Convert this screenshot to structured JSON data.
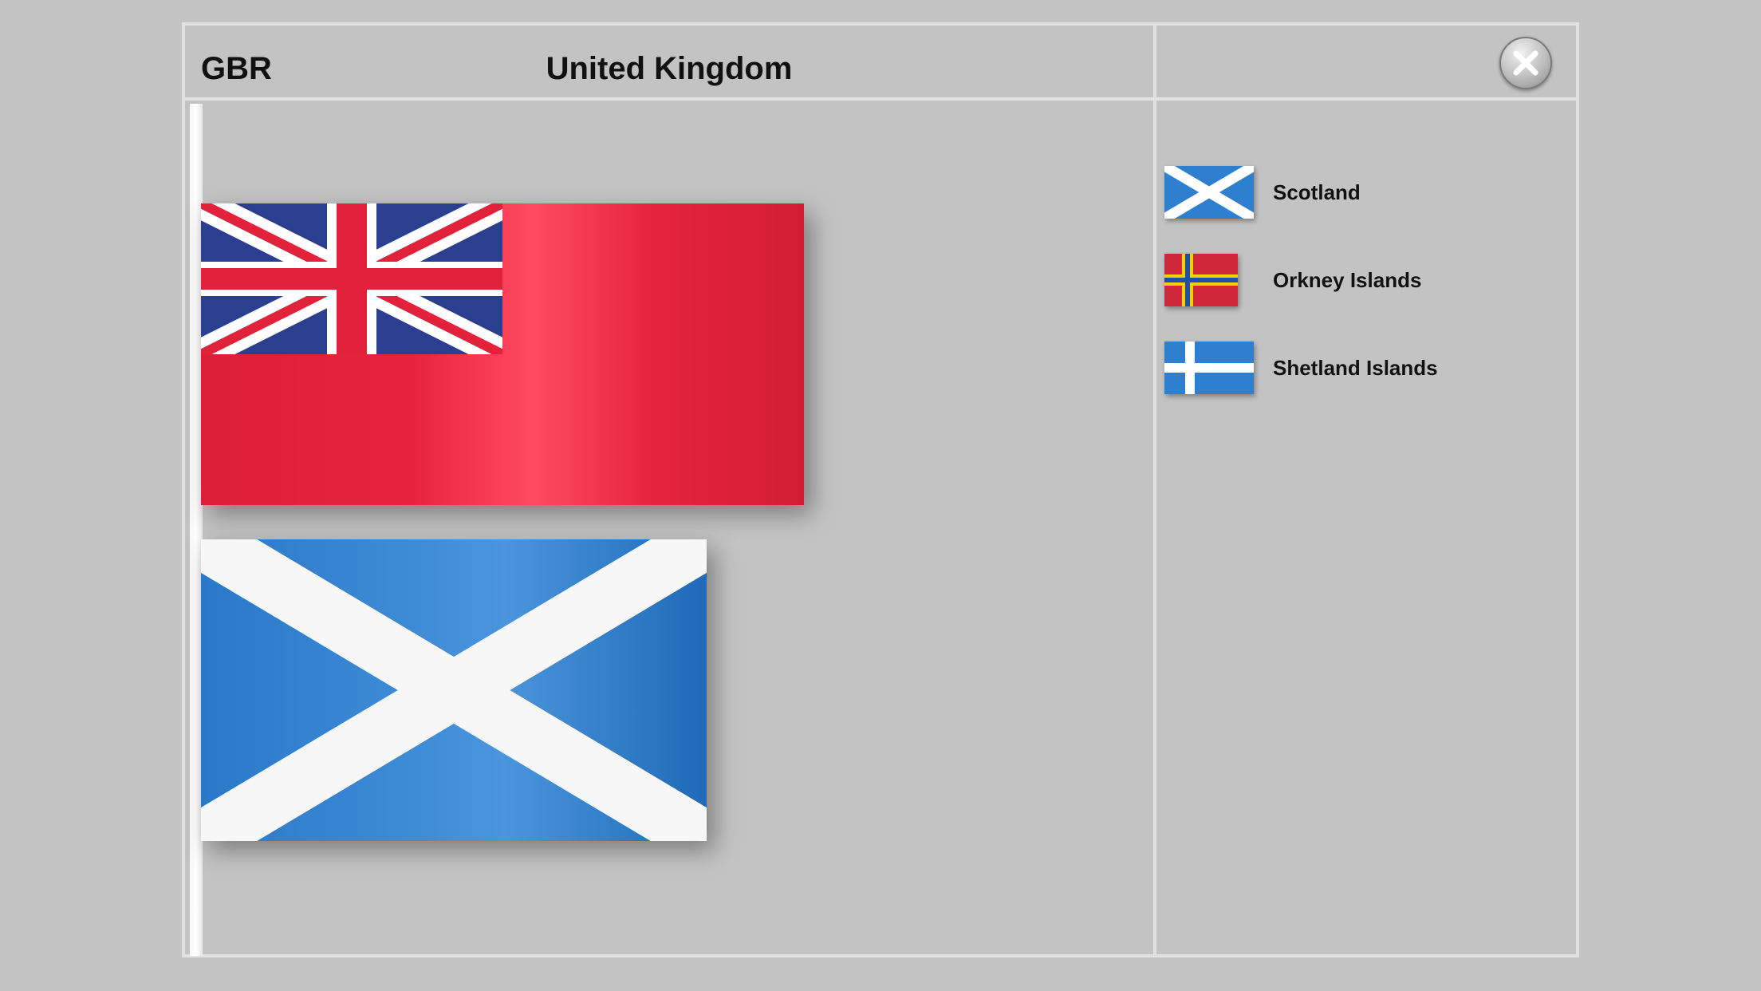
{
  "header": {
    "code": "GBR",
    "title": "United Kingdom"
  },
  "close_button": {
    "icon": "close-icon"
  },
  "main_flags": [
    {
      "name": "red-ensign",
      "colors": {
        "field": "#e2223a",
        "canton_blue": "#2a3f8f",
        "cross_red": "#e2223a",
        "white": "#ffffff"
      }
    },
    {
      "name": "saltire",
      "colors": {
        "field": "#2f7fd0",
        "white": "#ffffff"
      }
    }
  ],
  "subdivisions": [
    {
      "label": "Scotland",
      "flag_icon": "scotland-flag-icon"
    },
    {
      "label": "Orkney Islands",
      "flag_icon": "orkney-flag-icon"
    },
    {
      "label": "Shetland Islands",
      "flag_icon": "shetland-flag-icon"
    }
  ]
}
